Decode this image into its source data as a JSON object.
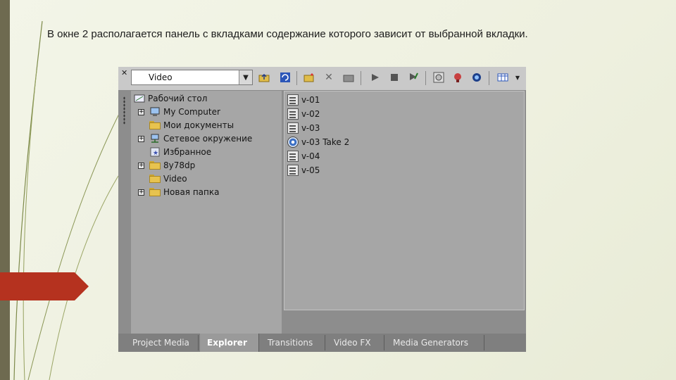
{
  "caption": "В окне 2 располагается панель с вкладками содержание которого зависит от выбранной вкладки.",
  "toolbar": {
    "close_glyph": "✕",
    "combo_value": "Video",
    "combo_arrow": "▼",
    "icons": [
      "folder-up-icon",
      "refresh-icon",
      "new-folder-icon",
      "delete-icon",
      "folder-icon",
      "play-icon",
      "stop-icon",
      "auto-preview-icon",
      "media-cd-icon",
      "record-icon",
      "find-icon",
      "views-icon"
    ]
  },
  "tree": [
    {
      "label": "Рабочий стол",
      "icon": "desktop-icon",
      "expander": ""
    },
    {
      "label": "My Computer",
      "icon": "computer-icon",
      "expander": "+"
    },
    {
      "label": "Мои документы",
      "icon": "folder-icon",
      "expander": ""
    },
    {
      "label": "Сетевое окружение",
      "icon": "network-icon",
      "expander": "+"
    },
    {
      "label": "Избранное",
      "icon": "favorites-icon",
      "expander": ""
    },
    {
      "label": "8y78dp",
      "icon": "folder-icon",
      "expander": "+"
    },
    {
      "label": "Video",
      "icon": "folder-icon",
      "expander": ""
    },
    {
      "label": "Новая папка",
      "icon": "folder-icon",
      "expander": "+"
    }
  ],
  "files": [
    {
      "label": "v-01",
      "icon": "video-file-icon"
    },
    {
      "label": "v-02",
      "icon": "video-file-icon"
    },
    {
      "label": "v-03",
      "icon": "video-file-icon"
    },
    {
      "label": "v-03 Take 2",
      "icon": "disc-file-icon"
    },
    {
      "label": "v-04",
      "icon": "video-file-icon"
    },
    {
      "label": "v-05",
      "icon": "video-file-icon"
    }
  ],
  "tabs": [
    {
      "label": "Project Media",
      "active": false
    },
    {
      "label": "Explorer",
      "active": true
    },
    {
      "label": "Transitions",
      "active": false
    },
    {
      "label": "Video FX",
      "active": false
    },
    {
      "label": "Media Generators",
      "active": false
    }
  ],
  "colors": {
    "slide_bg": "#f0f2e4",
    "side_bar": "#6e6a50",
    "accent_arrow": "#b5321f",
    "panel_bg": "#a6a6a6"
  }
}
